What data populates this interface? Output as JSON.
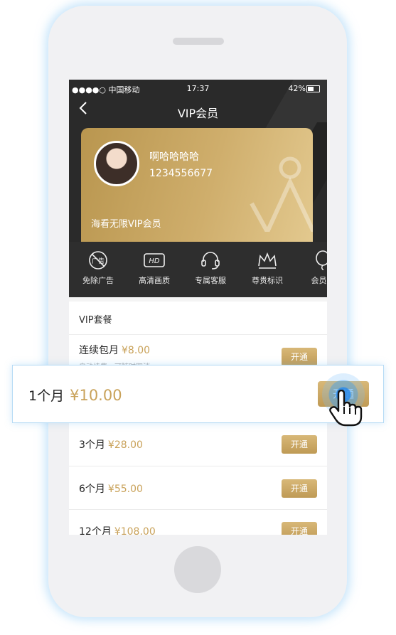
{
  "status_bar": {
    "carrier": "●●●●○ 中国移动",
    "time": "17:37",
    "battery": "42%"
  },
  "nav": {
    "back_icon": "chevron-left-icon",
    "title": "VIP会员"
  },
  "card": {
    "username": "啊哈哈哈哈",
    "user_id": "1234556677",
    "title": "海看无限VIP会员"
  },
  "privileges": [
    {
      "label": "免除广告",
      "icon": "no-ads-icon"
    },
    {
      "label": "高清画质",
      "icon": "hd-icon"
    },
    {
      "label": "专属客服",
      "icon": "headset-icon"
    },
    {
      "label": "尊贵标识",
      "icon": "crown-icon"
    },
    {
      "label": "会员活",
      "icon": "balloon-icon"
    }
  ],
  "packages": {
    "title": "VIP套餐",
    "items": [
      {
        "label": "连续包月",
        "price": "¥8.00",
        "sub": "自动续费，可随时取消",
        "button": "开通"
      },
      {
        "label": "3个月",
        "price": "¥28.00",
        "button": "开通"
      },
      {
        "label": "6个月",
        "price": "¥55.00",
        "button": "开通"
      },
      {
        "label": "12个月",
        "price": "¥108.00",
        "button": "开通"
      }
    ]
  },
  "popup": {
    "label": "1个月",
    "price": "¥10.00",
    "button": "开通"
  },
  "colors": {
    "gold": "#c9a25a",
    "dark_bg": "#2a2a2a",
    "glow": "#8ec8f5"
  }
}
